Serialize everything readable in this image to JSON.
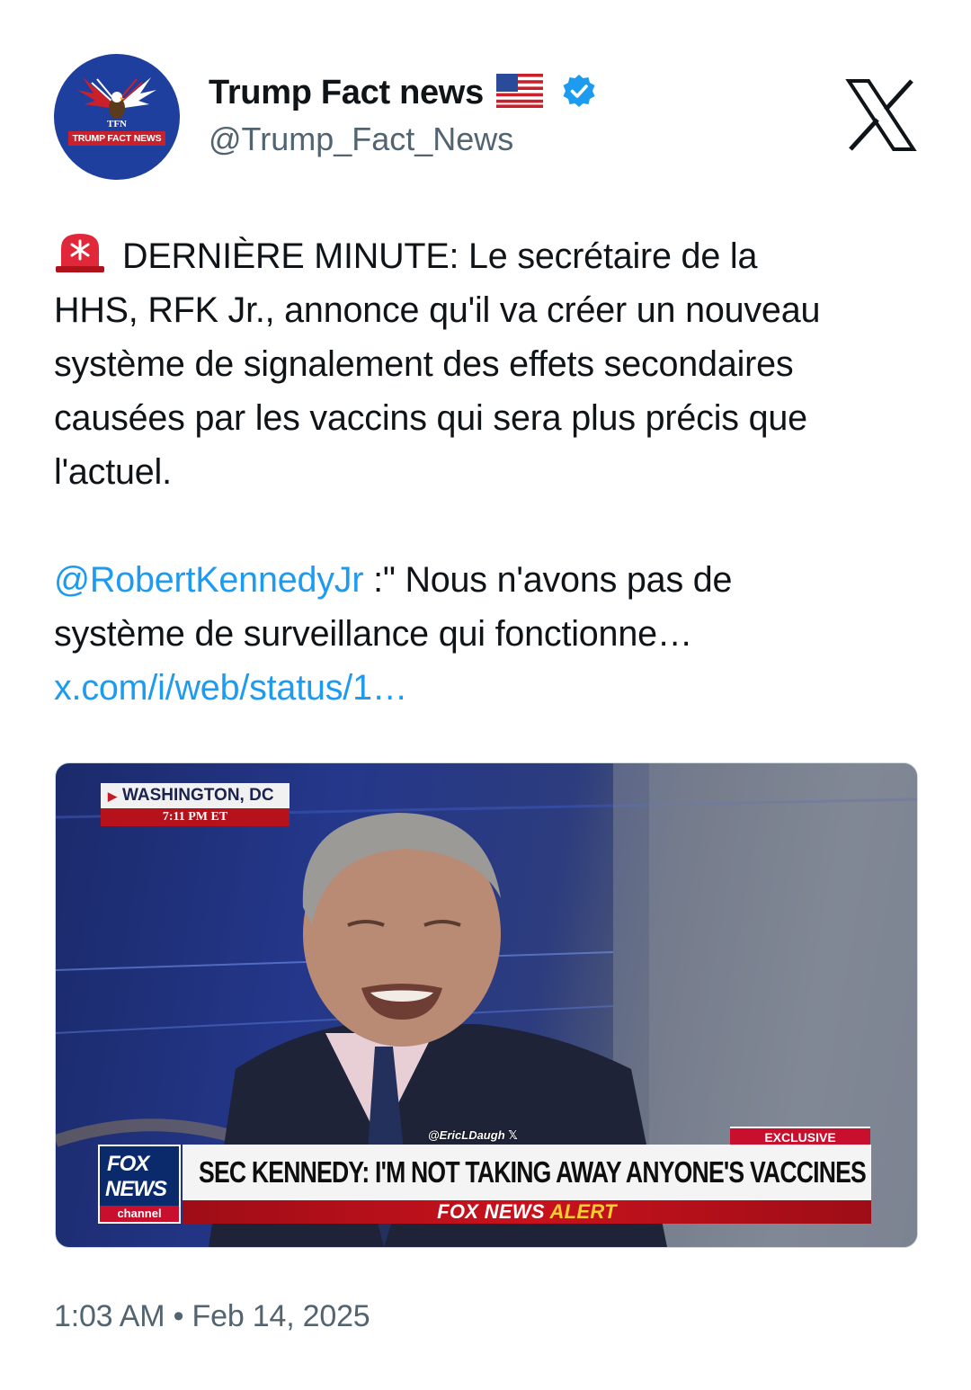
{
  "account": {
    "display_name": "Trump Fact news",
    "handle": "@Trump_Fact_News",
    "avatar_small_text": "TFN",
    "avatar_band_text": "TRUMP FACT NEWS",
    "verified_color": "#1d9bf0"
  },
  "tweet": {
    "lines": [
      "DERNIÈRE MINUTE: Le secrétaire de la",
      "HHS, RFK Jr., annonce qu'il va créer un nouveau",
      "système de signalement des effets secondaires",
      "causées par les vaccins qui sera plus précis que",
      "l'actuel."
    ],
    "mention": "@RobertKennedyJr",
    "quote_line1_rest": " :\" Nous n'avons pas de",
    "quote_line2": "système de surveillance qui fonctionne…",
    "link": "x.com/i/web/status/1…",
    "link_color": "#1d9bf0"
  },
  "media": {
    "location": "WASHINGTON, DC",
    "time": "7:11 PM ET",
    "watermark": "@EricLDaugh 𝕏",
    "exclusive": "EXCLUSIVE",
    "headline": "SEC KENNEDY: I'M NOT TAKING AWAY ANYONE'S VACCINES",
    "alert_white": "FOX NEWS",
    "alert_yellow": "ALERT",
    "logo_line1": "FOX",
    "logo_line2": "NEWS",
    "logo_line3": "channel"
  },
  "timestamp": "1:03 AM • Feb 14, 2025"
}
